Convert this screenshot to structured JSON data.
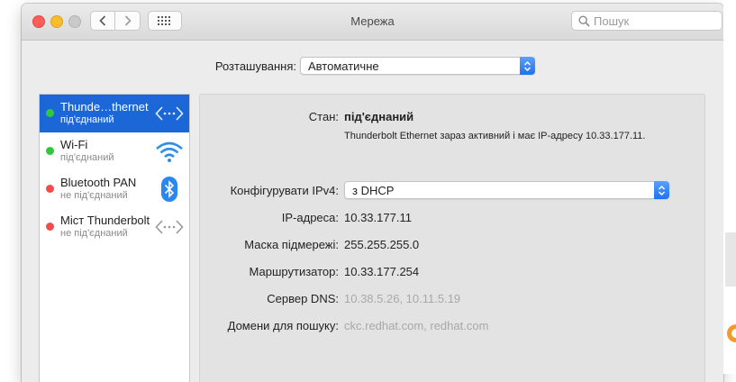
{
  "window": {
    "title": "Мережа"
  },
  "search": {
    "placeholder": "Пошук"
  },
  "location": {
    "label": "Розташування:",
    "value": "Автоматичне"
  },
  "services": [
    {
      "name": "Thunde…thernet",
      "status": "під'єднаний",
      "dot_color": "#2fc83d",
      "icon": "ethernet-arrows-icon",
      "selected": true
    },
    {
      "name": "Wi-Fi",
      "status": "під'єднаний",
      "dot_color": "#2fc83d",
      "icon": "wifi-icon",
      "selected": false
    },
    {
      "name": "Bluetooth PAN",
      "status": "не під'єднаний",
      "dot_color": "#f04c4c",
      "icon": "bluetooth-icon",
      "selected": false
    },
    {
      "name": "Міст Thunderbolt",
      "status": "не під'єднаний",
      "dot_color": "#f04c4c",
      "icon": "bridge-arrows-icon",
      "selected": false
    }
  ],
  "details": {
    "status_label": "Стан:",
    "status_value": "під'єднаний",
    "status_description": "Thunderbolt Ethernet зараз активний і має IP-адресу 10.33.177.11.",
    "configure_label": "Конфігурувати IPv4:",
    "configure_value": "з DHCP",
    "ip_label": "IP-адреса:",
    "ip_value": "10.33.177.11",
    "mask_label": "Маска підмережі:",
    "mask_value": "255.255.255.0",
    "router_label": "Маршрутизатор:",
    "router_value": "10.33.177.254",
    "dns_label": "Сервер DNS:",
    "dns_value": "10.38.5.26, 10.11.5.19",
    "domains_label": "Домени для пошуку:",
    "domains_value": "ckc.redhat.com, redhat.com"
  },
  "colors": {
    "accent": "#1b67d8",
    "connected": "#2fc83d",
    "disconnected": "#f04c4c"
  }
}
